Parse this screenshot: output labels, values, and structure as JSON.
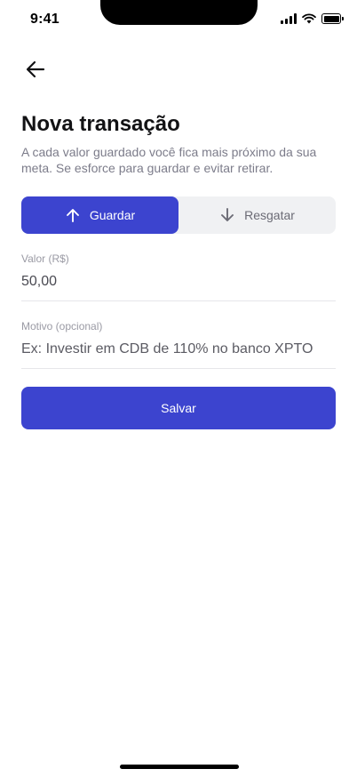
{
  "status_bar": {
    "time": "9:41"
  },
  "header": {
    "title": "Nova transação",
    "subtitle": "A cada valor guardado você fica mais próximo da sua meta. Se esforce para guardar e evitar retirar."
  },
  "segment": {
    "guardar_label": "Guardar",
    "resgatar_label": "Resgatar",
    "selected": "Guardar"
  },
  "form": {
    "valor_label": "Valor (R$)",
    "valor_value": "50,00",
    "motivo_label": "Motivo (opcional)",
    "motivo_placeholder": "Ex: Investir em CDB de 110% no banco XPTO"
  },
  "actions": {
    "save_label": "Salvar"
  },
  "colors": {
    "accent": "#3c44cf",
    "segment_bg": "#f0f1f3",
    "muted": "#7c7c8a"
  },
  "icons": {
    "back": "arrow-left-icon",
    "up": "arrow-up-icon",
    "down": "arrow-down-icon"
  }
}
